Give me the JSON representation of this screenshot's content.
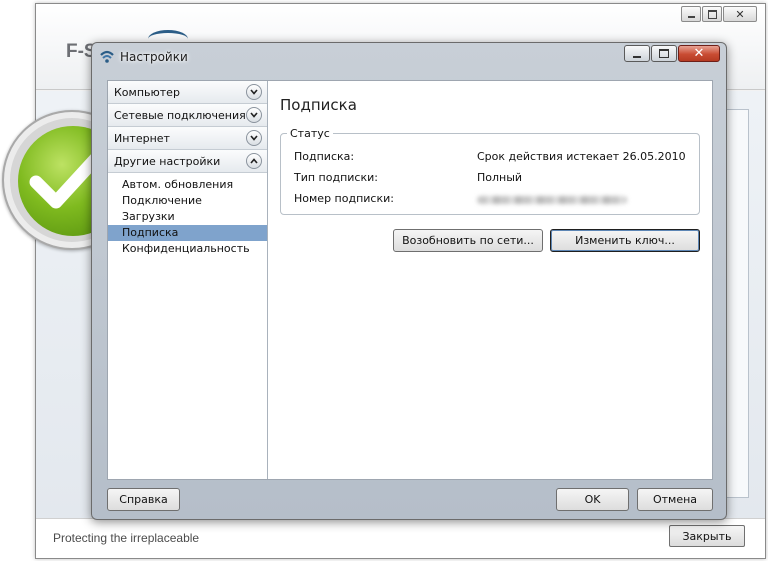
{
  "background_app": {
    "logo": "F-S",
    "tagline": "Protecting the irreplaceable",
    "close_label": "Закрыть"
  },
  "dialog": {
    "title": "Настройки",
    "close_glyph": "✕"
  },
  "nav": {
    "sections": [
      {
        "label": "Компьютер",
        "expanded": false
      },
      {
        "label": "Сетевые подключения",
        "expanded": false
      },
      {
        "label": "Интернет",
        "expanded": false
      },
      {
        "label": "Другие настройки",
        "expanded": true
      }
    ],
    "sub_items": [
      {
        "label": "Автом. обновления"
      },
      {
        "label": "Подключение"
      },
      {
        "label": "Загрузки"
      },
      {
        "label": "Подписка",
        "selected": true
      },
      {
        "label": "Конфиденциальность"
      }
    ]
  },
  "content": {
    "title": "Подписка",
    "status_group": {
      "legend": "Статус",
      "rows": [
        {
          "label": "Подписка:",
          "value": "Срок действия истекает 26.05.2010"
        },
        {
          "label": "Тип подписки:",
          "value": "Полный"
        },
        {
          "label": "Номер подписки:",
          "value": ""
        }
      ]
    },
    "renew_button": "Возобновить по сети...",
    "change_key_button": "Изменить ключ..."
  },
  "footer": {
    "help_button": "Справка",
    "ok_button": "OK",
    "cancel_button": "Отмена"
  },
  "colors": {
    "selection": "#7fa3cc",
    "close_button": "#c94c33",
    "status_green": "#7fba1f"
  }
}
